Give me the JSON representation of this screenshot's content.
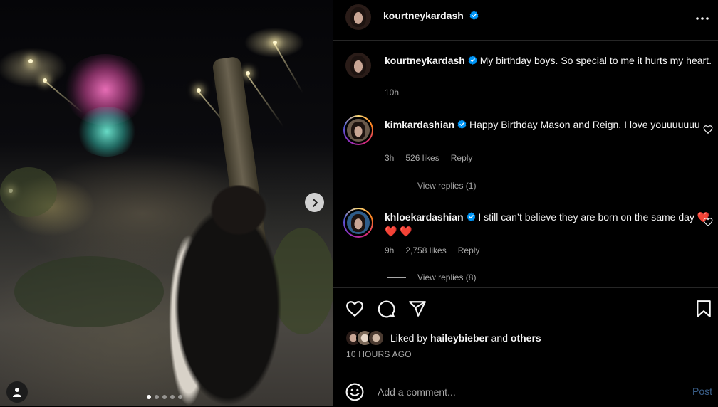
{
  "media": {
    "carousel_count": 5,
    "active_index": 0,
    "next_icon": "chevron-right-icon",
    "tag_icon": "person-icon"
  },
  "header": {
    "username": "kourtneykardash",
    "verified": true,
    "more_icon": "more-horizontal-icon"
  },
  "caption": {
    "username": "kourtneykardash",
    "text": "My birthday boys. So special to me it hurts my heart.",
    "time": "10h"
  },
  "comments": [
    {
      "username": "kimkardashian",
      "text": "Happy Birthday Mason and Reign. I love youuuuuuu",
      "time": "3h",
      "likes": "526 likes",
      "reply_label": "Reply",
      "view_replies": "View replies (1)"
    },
    {
      "username": "khloekardashian",
      "text": "I still can’t believe they are born on the same day",
      "hearts": "❤️ ❤️ ❤️",
      "time": "9h",
      "likes": "2,758 likes",
      "reply_label": "Reply",
      "view_replies": "View replies (8)"
    }
  ],
  "actions": {
    "like_icon": "heart-icon",
    "comment_icon": "comment-icon",
    "share_icon": "send-icon",
    "save_icon": "bookmark-icon"
  },
  "likes": {
    "prefix": "Liked by",
    "user": "haileybieber",
    "conjunction": "and",
    "others": "others"
  },
  "time_ago": "10 HOURS AGO",
  "add_comment": {
    "placeholder": "Add a comment...",
    "post_label": "Post",
    "emoji_icon": "emoji-icon"
  },
  "colors": {
    "verified": "#0095f6",
    "heart_red": "#ff3040",
    "post_button": "#3a5f8a",
    "secondary_text": "#a8a8a8"
  }
}
